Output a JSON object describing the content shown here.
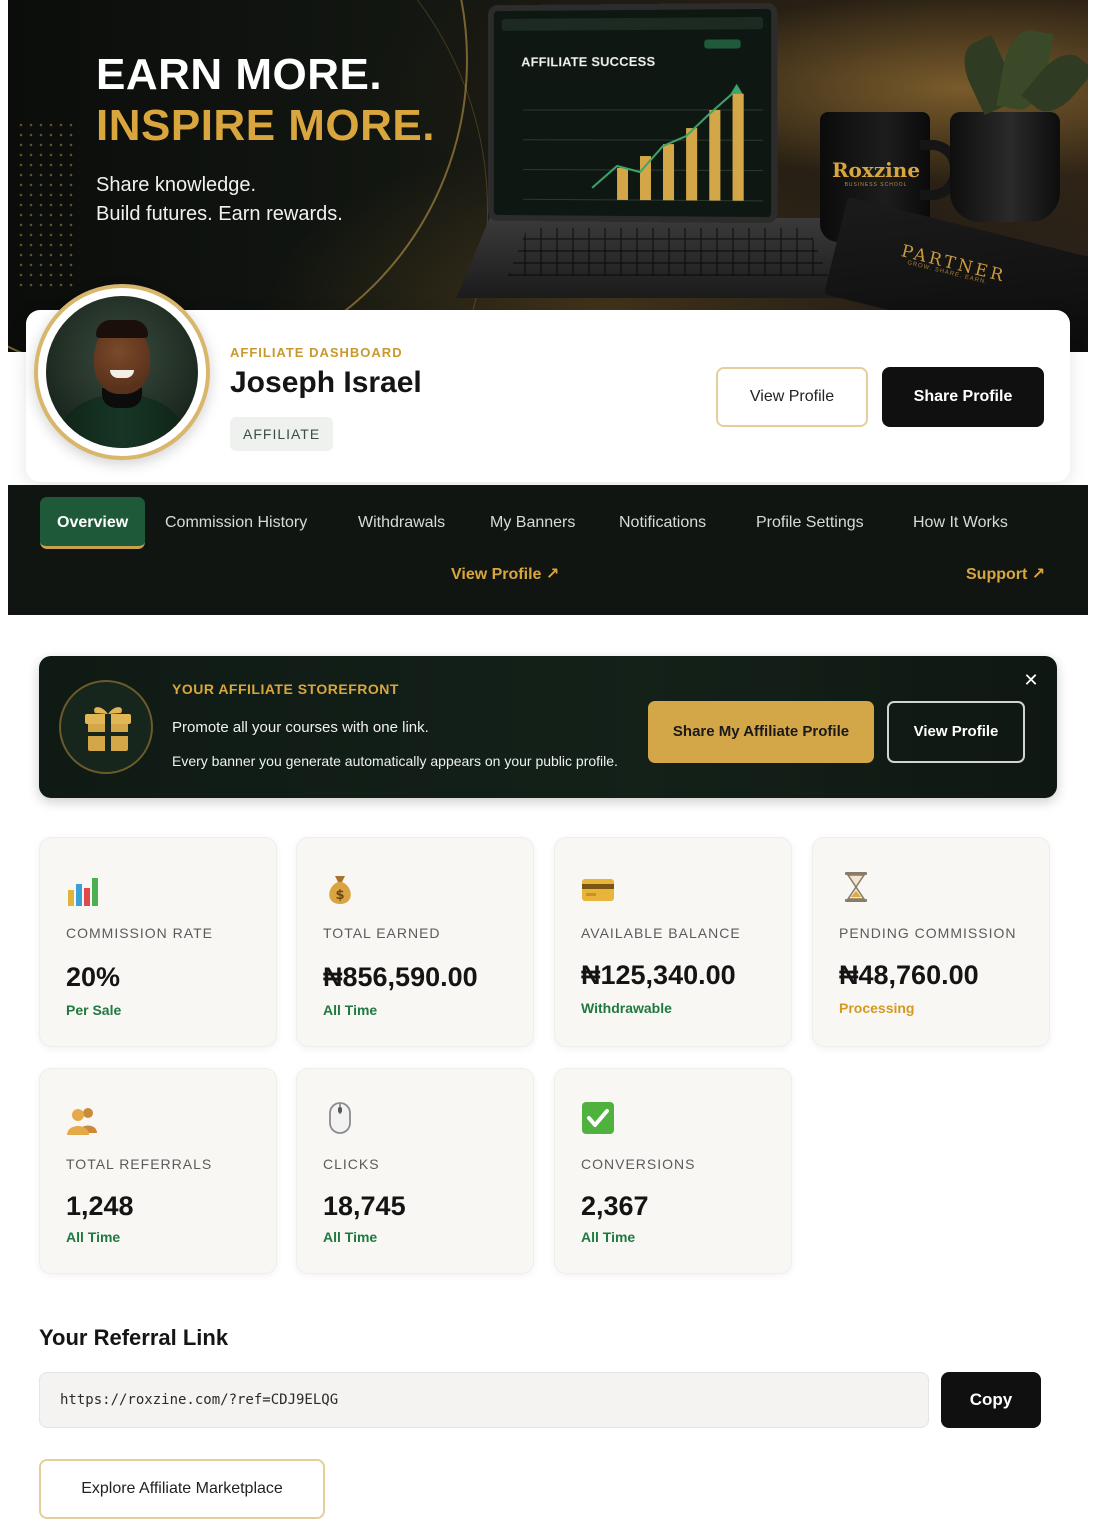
{
  "hero": {
    "title_line1": "EARN MORE.",
    "title_line2": "INSPIRE MORE.",
    "subtitle_line1": "Share knowledge.",
    "subtitle_line2": "Build futures. Earn rewards.",
    "laptop_heading": "AFFILIATE SUCCESS",
    "mug_brand": "Roxzine",
    "mug_sub": "BUSINESS SCHOOL",
    "notebook_text": "PARTNER",
    "notebook_sub": "GROW. SHARE. EARN."
  },
  "profile": {
    "section_label": "AFFILIATE DASHBOARD",
    "name": "Joseph Israel",
    "role": "AFFILIATE",
    "view_profile_label": "View Profile",
    "share_profile_label": "Share Profile"
  },
  "nav": {
    "tabs": [
      {
        "label": "Overview",
        "active": true
      },
      {
        "label": "Commission History"
      },
      {
        "label": "Withdrawals"
      },
      {
        "label": "My Banners"
      },
      {
        "label": "Notifications"
      },
      {
        "label": "Profile Settings"
      },
      {
        "label": "How It Works"
      }
    ],
    "view_profile_link": "View Profile ↗",
    "support_link": "Support ↗"
  },
  "storefront": {
    "title": "YOUR AFFILIATE STOREFRONT",
    "line1": "Promote all your courses with one link.",
    "line2": "Every banner you generate automatically appears on your public profile.",
    "share_button": "Share My Affiliate Profile",
    "view_button": "View Profile",
    "close_icon": "close-icon"
  },
  "stats": [
    {
      "icon": "bar-chart-icon",
      "label": "COMMISSION RATE",
      "value": "20%",
      "note": "Per Sale",
      "note_color": "#1f7a3f"
    },
    {
      "icon": "money-bag-icon",
      "label": "TOTAL EARNED",
      "value": "₦856,590.00",
      "note": "All Time",
      "note_color": "#1f7a3f"
    },
    {
      "icon": "credit-card-icon",
      "label": "AVAILABLE BALANCE",
      "value": "₦125,340.00",
      "note": "Withdrawable",
      "note_color": "#1f7a3f"
    },
    {
      "icon": "hourglass-icon",
      "label": "PENDING COMMISSION",
      "value": "₦48,760.00",
      "note": "Processing",
      "note_color": "#d39a22"
    },
    {
      "icon": "users-icon",
      "label": "TOTAL REFERRALS",
      "value": "1,248",
      "note": "All Time",
      "note_color": "#1f7a3f"
    },
    {
      "icon": "mouse-icon",
      "label": "CLICKS",
      "value": "18,745",
      "note": "All Time",
      "note_color": "#1f7a3f"
    },
    {
      "icon": "check-icon",
      "label": "CONVERSIONS",
      "value": "2,367",
      "note": "All Time",
      "note_color": "#1f7a3f"
    }
  ],
  "referral": {
    "title": "Your Referral Link",
    "link": "https://roxzine.com/?ref=CDJ9ELQG",
    "copy_label": "Copy",
    "explore_label": "Explore Affiliate Marketplace"
  },
  "colors": {
    "accent_gold": "#d9a63d",
    "dark_green": "#1e5a39",
    "nav_bg": "#101511"
  }
}
